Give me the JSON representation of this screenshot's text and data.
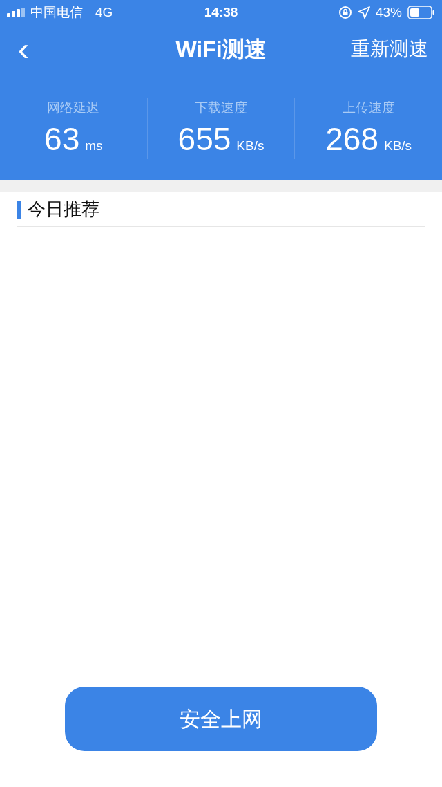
{
  "status_bar": {
    "carrier": "中国电信",
    "network": "4G",
    "time": "14:38",
    "battery": "43%"
  },
  "nav": {
    "back": "‹",
    "title": "WiFi测速",
    "action": "重新测速"
  },
  "stats": [
    {
      "label": "网络延迟",
      "value": "63",
      "unit": "ms"
    },
    {
      "label": "下载速度",
      "value": "655",
      "unit": "KB/s"
    },
    {
      "label": "上传速度",
      "value": "268",
      "unit": "KB/s"
    }
  ],
  "section": {
    "title": "今日推荐"
  },
  "primary_button": "安全上网"
}
